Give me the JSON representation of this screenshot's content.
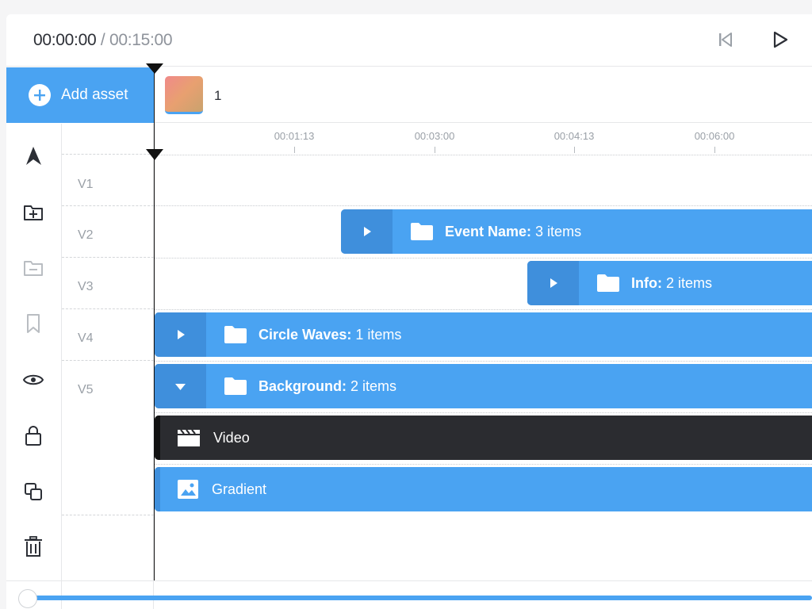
{
  "timecode": {
    "current": "00:00:00",
    "separator": " / ",
    "total": "00:15:00"
  },
  "transport": {
    "skip_back_icon": "skip-to-start-icon",
    "play_icon": "play-icon"
  },
  "assets": {
    "add_label": "Add asset",
    "count": "1"
  },
  "tools": [
    "pointer-arrow-icon",
    "add-folder-icon",
    "remove-folder-icon",
    "bookmark-icon",
    "eye-icon",
    "lock-icon",
    "duplicate-icon",
    "trash-icon"
  ],
  "ruler": {
    "ticks": [
      "00:01:13",
      "00:03:00",
      "00:04:13",
      "00:06:00"
    ]
  },
  "tracks": {
    "labels": [
      "V1",
      "V2",
      "V3",
      "V4",
      "V5"
    ]
  },
  "clips": {
    "event_name": {
      "name": "Event Name:",
      "detail": "3 items",
      "state": "collapsed"
    },
    "info": {
      "name": "Info:",
      "detail": "2 items",
      "state": "collapsed"
    },
    "circle_waves": {
      "name": "Circle Waves:",
      "detail": "1 items",
      "state": "collapsed"
    },
    "background": {
      "name": "Background:",
      "detail": "2 items",
      "state": "expanded"
    },
    "video": {
      "name": "Video"
    },
    "gradient": {
      "name": "Gradient"
    }
  },
  "colors": {
    "accent": "#4aa3f2",
    "accent_dark": "#3f8fdc",
    "clip_dark": "#2b2c30",
    "text": "#2c2f36",
    "muted": "#9aa0a7"
  }
}
